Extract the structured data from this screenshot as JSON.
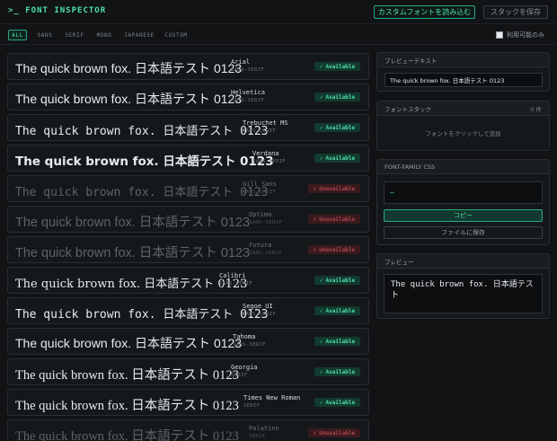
{
  "app": {
    "title": ">_ FONT INSPECTOR",
    "load_button": "カスタムフォントを読み込む",
    "save_stack_button": "スタックを保存",
    "accent_color": "#4ee0b0"
  },
  "filters": {
    "items": [
      "ALL",
      "SANS",
      "SERIF",
      "MONO",
      "JAPANESE",
      "CUSTOM"
    ],
    "selected": "ALL",
    "available_only_label": "利用可能のみ",
    "available_only_checked": false
  },
  "sample_text": "The quick brown fox. 日本語テスト 0123",
  "status_labels": {
    "available": "Available",
    "unavailable": "Unavailable",
    "available_icon": "✓",
    "unavailable_icon": "✗"
  },
  "fonts": [
    {
      "name": "Arial",
      "category": "SANS-SERIF",
      "available": true
    },
    {
      "name": "Helvetica",
      "category": "SANS-SERIF",
      "available": true
    },
    {
      "name": "Trebuchet MS",
      "category": "SANS-SERIF",
      "available": true
    },
    {
      "name": "Verdana",
      "category": "SANS-SERIF",
      "available": true
    },
    {
      "name": "Gill Sans",
      "category": "SANS-SERIF",
      "available": false
    },
    {
      "name": "Optima",
      "category": "SANS-SERIF",
      "available": false
    },
    {
      "name": "Futura",
      "category": "SANS-SERIF",
      "available": false
    },
    {
      "name": "Calibri",
      "category": "SANS-SERIF",
      "available": true
    },
    {
      "name": "Segoe UI",
      "category": "SANS-SERIF",
      "available": true
    },
    {
      "name": "Tahoma",
      "category": "SANS-SERIF",
      "available": true
    },
    {
      "name": "Georgia",
      "category": "SERIF",
      "available": true
    },
    {
      "name": "Times New Roman",
      "category": "SERIF",
      "available": true
    },
    {
      "name": "Palatino",
      "category": "SERIF",
      "available": false
    }
  ],
  "panels": {
    "preview_text": {
      "title": "プレビューテキスト",
      "value": "The quick brown fox. 日本語テスト 0123"
    },
    "font_stack": {
      "title": "フォントスタック",
      "count": "0 件",
      "empty_message": "フォントをクリックして追加"
    },
    "css": {
      "title": "FONT-FAMILY CSS",
      "value": "—",
      "copy_button": "コピー",
      "save_button": "ファイルに保存"
    },
    "preview": {
      "title": "プレビュー",
      "text": "The quick brown fox. 日本語テスト"
    }
  }
}
